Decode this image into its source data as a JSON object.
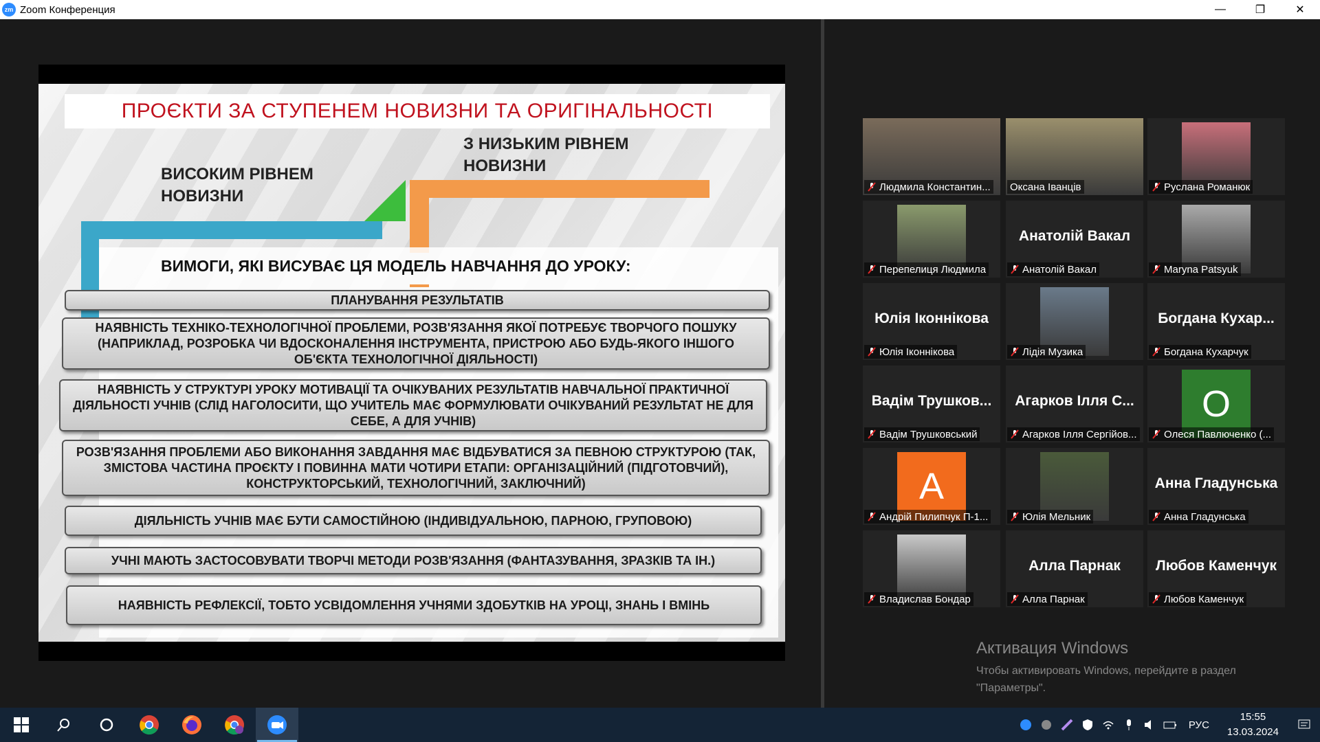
{
  "window": {
    "logo_text": "zm",
    "title": "Zoom Конференция",
    "minimize": "—",
    "restore": "❐",
    "close": "✕"
  },
  "slide": {
    "title": "ПРОЄКТИ ЗА СТУПЕНЕМ НОВИЗНИ ТА ОРИГІНАЛЬНОСТІ",
    "high_label": "ВИСОКИМ РІВНЕМ НОВИЗНИ",
    "low_label": "З НИЗЬКИМ РІВНЕМ НОВИЗНИ",
    "requirements_heading": "ВИМОГИ, ЯКІ ВИСУВАЄ ЦЯ МОДЕЛЬ НАВЧАННЯ ДО УРОКУ:",
    "requirements": [
      "ПЛАНУВАННЯ РЕЗУЛЬТАТІВ",
      "НАЯВНІСТЬ ТЕХНІКО-ТЕХНОЛОГІЧНОЇ ПРОБЛЕМИ, РОЗВ'ЯЗАННЯ ЯКОЇ ПОТРЕБУЄ ТВОРЧОГО ПОШУКУ (НАПРИКЛАД, РОЗРОБКА ЧИ ВДОСКОНАЛЕННЯ ІНСТРУМЕНТА, ПРИСТРОЮ АБО БУДЬ-ЯКОГО ІНШОГО ОБ'ЄКТА ТЕХНОЛОГІЧНОЇ ДІЯЛЬНОСТІ)",
      "НАЯВНІСТЬ У СТРУКТУРІ УРОКУ МОТИВАЦІЇ ТА ОЧІКУВАНИХ РЕЗУЛЬТАТІВ НАВЧАЛЬНОЇ ПРАКТИЧНОЇ ДІЯЛЬНОСТІ УЧНІВ (СЛІД НАГОЛОСИТИ, ЩО УЧИТЕЛЬ МАЄ ФОРМУЛЮВАТИ ОЧІКУВАНИЙ РЕЗУЛЬТАТ НЕ ДЛЯ СЕБЕ, А ДЛЯ УЧНІВ)",
      "РОЗВ'ЯЗАННЯ ПРОБЛЕМИ АБО ВИКОНАННЯ ЗАВДАННЯ МАЄ ВІДБУВАТИСЯ ЗА ПЕВНОЮ СТРУКТУРОЮ (ТАК, ЗМІСТОВА ЧАСТИНА ПРОЄКТУ І ПОВИННА МАТИ ЧОТИРИ ЕТАПИ: ОРГАНІЗАЦІЙНИЙ (ПІДГОТОВЧИЙ), КОНСТРУКТОРСЬКИЙ, ТЕХНОЛОГІЧНИЙ, ЗАКЛЮЧНИЙ)",
      "ДІЯЛЬНІСТЬ УЧНІВ МАЄ БУТИ САМОСТІЙНОЮ (ІНДИВІДУАЛЬНОЮ, ПАРНОЮ, ГРУПОВОЮ)",
      "УЧНІ МАЮТЬ ЗАСТОСОВУВАТИ ТВОРЧІ МЕТОДИ РОЗВ'ЯЗАННЯ (ФАНТАЗУВАННЯ, ЗРАЗКІВ ТА ІН.)",
      "НАЯВНІСТЬ РЕФЛЕКСІЇ, ТОБТО УСВІДОМЛЕННЯ УЧНЯМИ ЗДОБУТКІВ НА УРОЦІ, ЗНАНЬ І ВМІНЬ"
    ],
    "colors": {
      "title": "#c0121e",
      "blue_step": "#3ba7c9",
      "green_step": "#3dbd3d",
      "orange_step": "#f39a4a"
    }
  },
  "participants": [
    {
      "name": "Людмила Константин...",
      "display": "photo",
      "muted": true
    },
    {
      "name": "Оксана Іванців",
      "display": "photo",
      "muted": false,
      "active_speaker": true
    },
    {
      "name": "Руслана Романюк",
      "display": "photo",
      "muted": true
    },
    {
      "name": "Перепелиця Людмила",
      "display": "photo",
      "muted": true
    },
    {
      "name": "Анатолій Вакал",
      "big": "Анатолій Вакал",
      "display": "name",
      "muted": true
    },
    {
      "name": "Maryna Patsyuk",
      "display": "photo",
      "muted": true
    },
    {
      "name": "Юлія Іконнікова",
      "big": "Юлія Іконнікова",
      "display": "name",
      "muted": true
    },
    {
      "name": "Лідія Музика",
      "display": "photo",
      "muted": true
    },
    {
      "name": "Богдана Кухарчук",
      "big": "Богдана Кухар...",
      "display": "name",
      "muted": true
    },
    {
      "name": "Вадім Трушковський",
      "big": "Вадім Трушков...",
      "display": "name",
      "muted": true
    },
    {
      "name": "Агарков Ілля Сергійов...",
      "big": "Агарков Ілля С...",
      "display": "name",
      "muted": true
    },
    {
      "name": "Олеся Павлюченко (...",
      "display": "letter",
      "letter": "О",
      "letter_bg": "#2e7d2e",
      "muted": true
    },
    {
      "name": "Андрій Пилипчук П-1...",
      "display": "letter",
      "letter": "А",
      "letter_bg": "#f26b1d",
      "muted": true
    },
    {
      "name": "Юлія Мельник",
      "display": "photo",
      "muted": true
    },
    {
      "name": "Анна Гладунська",
      "big": "Анна Гладунська",
      "display": "name",
      "muted": true
    },
    {
      "name": "Владислав Бондар",
      "display": "photo",
      "muted": true
    },
    {
      "name": "Алла Парнак",
      "big": "Алла Парнак",
      "display": "name",
      "muted": true
    },
    {
      "name": "Любов Каменчук",
      "big": "Любов Каменчук",
      "display": "name",
      "muted": true
    }
  ],
  "watermark": {
    "title": "Активация Windows",
    "text": "Чтобы активировать Windows, перейдите в раздел \"Параметры\"."
  },
  "taskbar": {
    "apps": [
      "start-icon",
      "search-icon",
      "cortana-icon",
      "chrome-icon",
      "firefox-icon",
      "chrome-profile-icon",
      "zoom-icon"
    ],
    "lang": "РУС",
    "time": "15:55",
    "date": "13.03.2024"
  }
}
